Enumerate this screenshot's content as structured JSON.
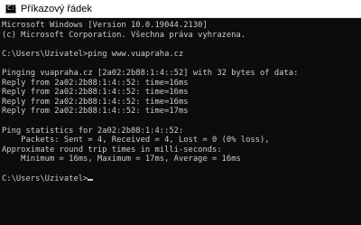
{
  "window": {
    "title": "Příkazový řádek",
    "icon": "cmd-console-icon"
  },
  "console": {
    "lines": [
      "Microsoft Windows [Version 10.0.19044.2130]",
      "(c) Microsoft Corporation. Všechna práva vyhrazena.",
      "",
      "C:\\Users\\Uzivatel>ping www.vuapraha.cz",
      "",
      "Pinging vuapraha.cz [2a02:2b88:1:4::52] with 32 bytes of data:",
      "Reply from 2a02:2b88:1:4::52: time=16ms",
      "Reply from 2a02:2b88:1:4::52: time=16ms",
      "Reply from 2a02:2b88:1:4::52: time=16ms",
      "Reply from 2a02:2b88:1:4::52: time=17ms",
      "",
      "Ping statistics for 2a02:2b88:1:4::52:",
      "    Packets: Sent = 4, Received = 4, Lost = 0 (0% loss),",
      "Approximate round trip times in milli-seconds:",
      "    Minimum = 16ms, Maximum = 17ms, Average = 16ms",
      ""
    ],
    "prompt": "C:\\Users\\Uzivatel>"
  },
  "colors": {
    "background": "#0c0c0c",
    "text": "#cccccc",
    "titlebar": "#ffffff"
  }
}
